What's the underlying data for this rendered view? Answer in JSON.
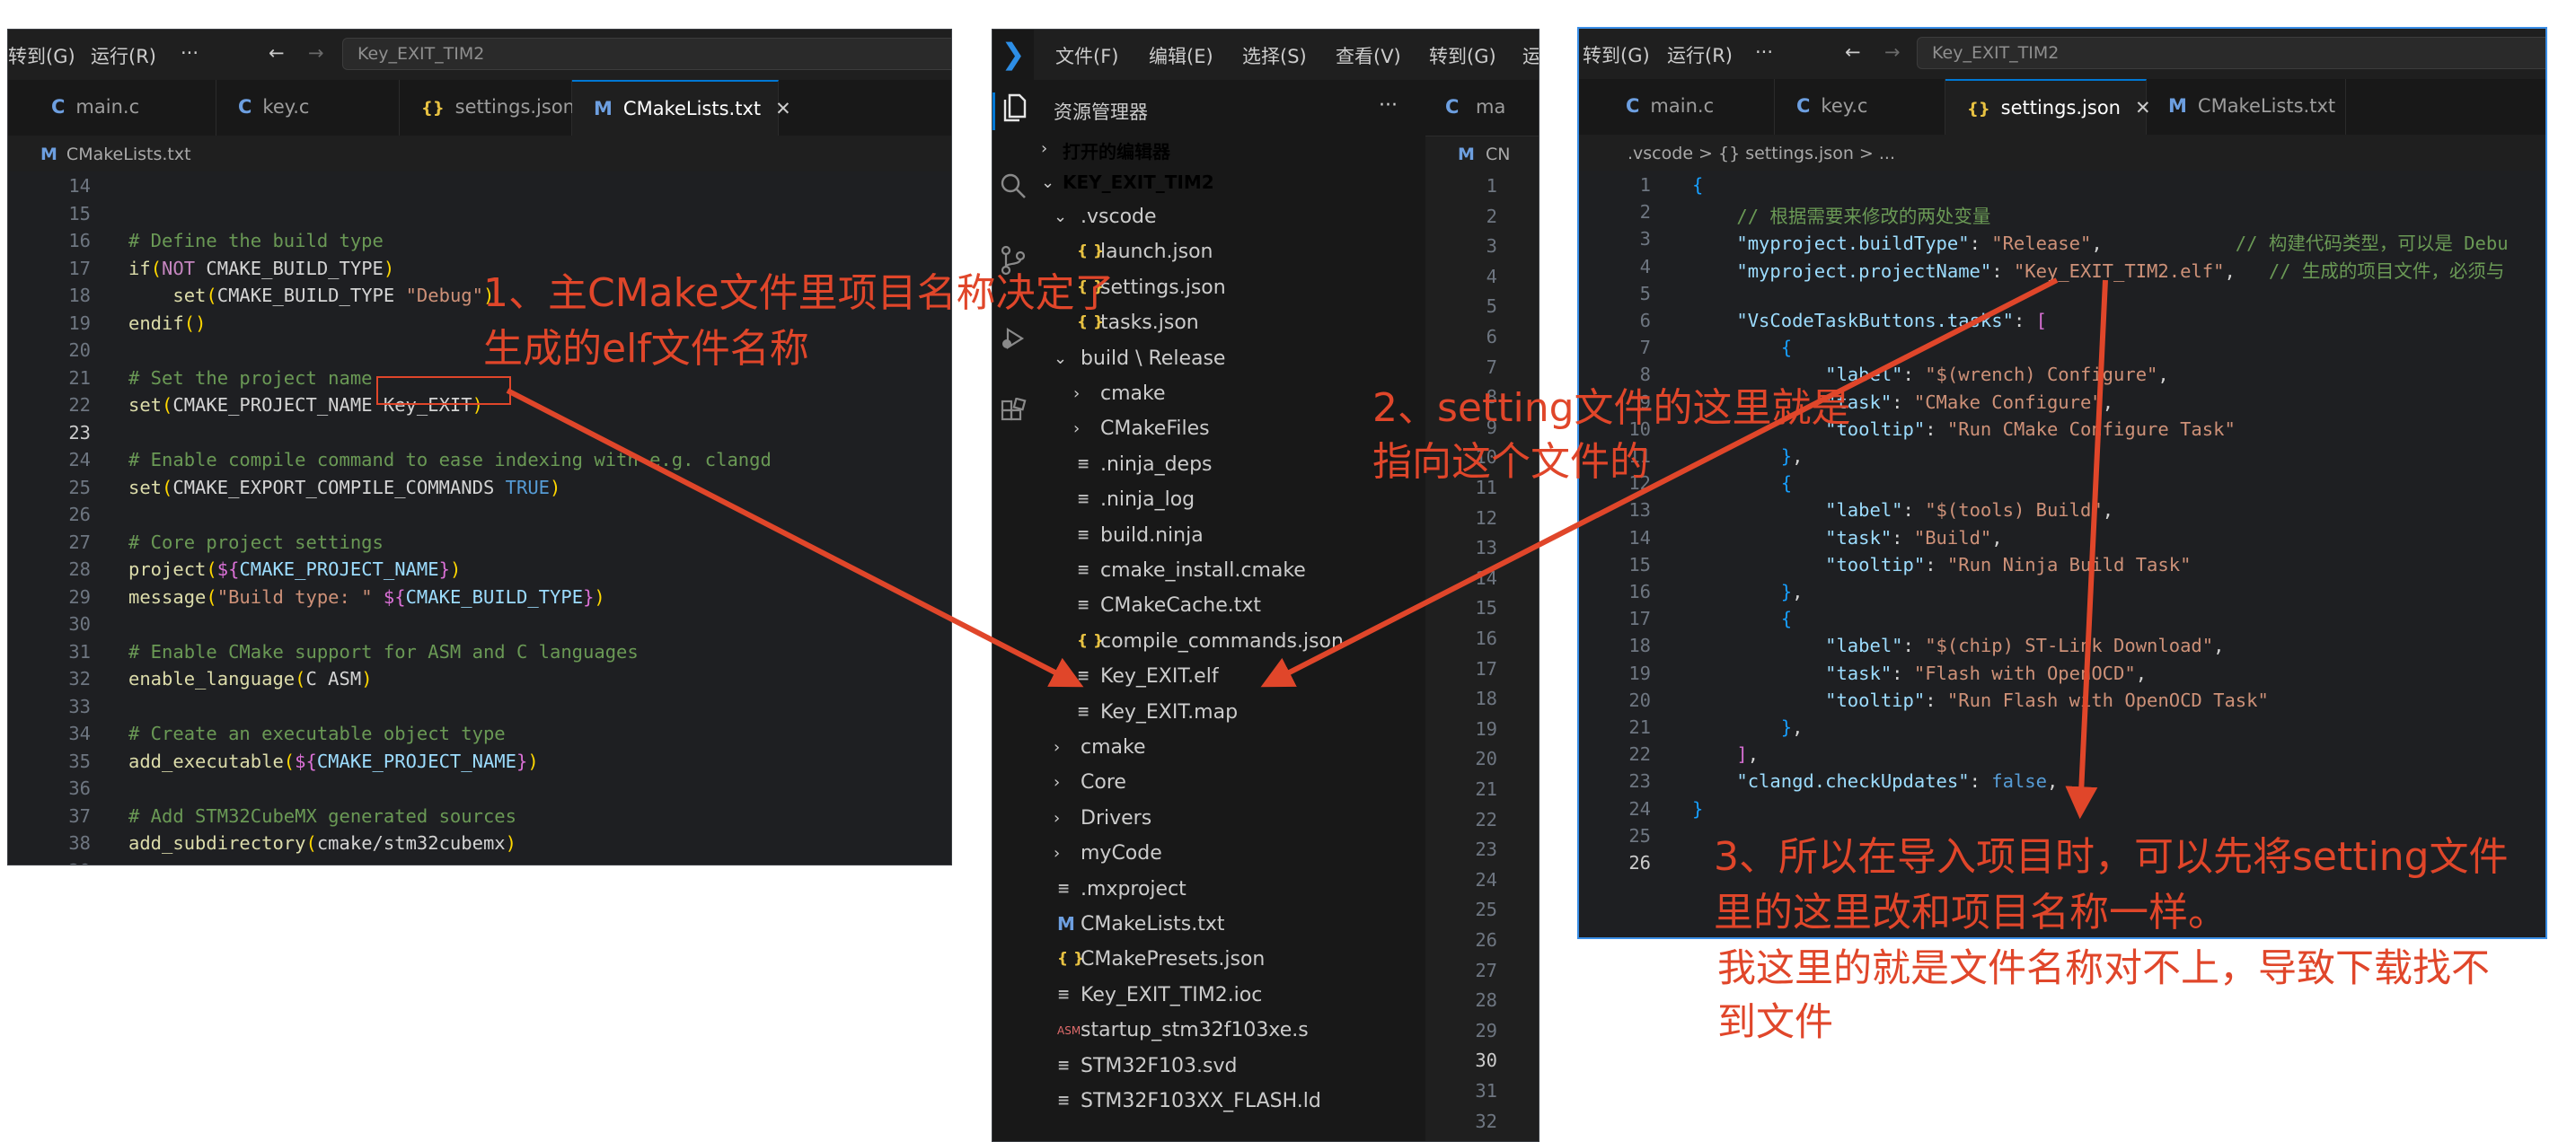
{
  "left_window": {
    "menu": [
      "转到(G)",
      "运行(R)"
    ],
    "more": "···",
    "nav_back": "←",
    "nav_forward": "→",
    "search": "Key_EXIT_TIM2",
    "tabs": [
      {
        "icon": "C",
        "label": "main.c"
      },
      {
        "icon": "C",
        "label": "key.c"
      },
      {
        "icon": "{}",
        "label": "settings.json"
      },
      {
        "icon": "M",
        "label": "CMakeLists.txt",
        "active": true
      }
    ],
    "breadcrumb": "CMakeLists.txt",
    "lines": [
      {
        "n": "14",
        "t": ""
      },
      {
        "n": "15",
        "t": ""
      },
      {
        "n": "16",
        "t": "# Define the build type"
      },
      {
        "n": "17",
        "t": "if(NOT CMAKE_BUILD_TYPE)"
      },
      {
        "n": "18",
        "t": "    set(CMAKE_BUILD_TYPE \"Debug\")"
      },
      {
        "n": "19",
        "t": "endif()"
      },
      {
        "n": "20",
        "t": ""
      },
      {
        "n": "21",
        "t": "# Set the project name"
      },
      {
        "n": "22",
        "t": "set(CMAKE_PROJECT_NAME Key_EXIT)"
      },
      {
        "n": "23",
        "t": ""
      },
      {
        "n": "24",
        "t": "# Enable compile command to ease indexing with e.g. clangd"
      },
      {
        "n": "25",
        "t": "set(CMAKE_EXPORT_COMPILE_COMMANDS TRUE)"
      },
      {
        "n": "26",
        "t": ""
      },
      {
        "n": "27",
        "t": "# Core project settings"
      },
      {
        "n": "28",
        "t": "project(${CMAKE_PROJECT_NAME})"
      },
      {
        "n": "29",
        "t": "message(\"Build type: \" ${CMAKE_BUILD_TYPE})"
      },
      {
        "n": "30",
        "t": ""
      },
      {
        "n": "31",
        "t": "# Enable CMake support for ASM and C languages"
      },
      {
        "n": "32",
        "t": "enable_language(C ASM)"
      },
      {
        "n": "33",
        "t": ""
      },
      {
        "n": "34",
        "t": "# Create an executable object type"
      },
      {
        "n": "35",
        "t": "add_executable(${CMAKE_PROJECT_NAME})"
      },
      {
        "n": "36",
        "t": ""
      },
      {
        "n": "37",
        "t": "# Add STM32CubeMX generated sources"
      },
      {
        "n": "38",
        "t": "add_subdirectory(cmake/stm32cubemx)"
      },
      {
        "n": "39",
        "t": ""
      }
    ]
  },
  "middle_window": {
    "menu": [
      "文件(F)",
      "编辑(E)",
      "选择(S)",
      "查看(V)",
      "转到(G)",
      "运"
    ],
    "explorer_title": "资源管理器",
    "more": "···",
    "open_editors": "打开的编辑器",
    "root": "KEY_EXIT_TIM2",
    "tree": [
      {
        "depth": 1,
        "chev": "v",
        "icon": "",
        "label": ".vscode"
      },
      {
        "depth": 2,
        "chev": "",
        "icon": "json",
        "label": "launch.json"
      },
      {
        "depth": 2,
        "chev": "",
        "icon": "json",
        "label": "settings.json"
      },
      {
        "depth": 2,
        "chev": "",
        "icon": "json",
        "label": "tasks.json"
      },
      {
        "depth": 1,
        "chev": "v",
        "icon": "",
        "label": "build \\ Release"
      },
      {
        "depth": 2,
        "chev": ">",
        "icon": "",
        "label": "cmake"
      },
      {
        "depth": 2,
        "chev": ">",
        "icon": "",
        "label": "CMakeFiles"
      },
      {
        "depth": 2,
        "chev": "",
        "icon": "txt",
        "label": ".ninja_deps"
      },
      {
        "depth": 2,
        "chev": "",
        "icon": "txt",
        "label": ".ninja_log"
      },
      {
        "depth": 2,
        "chev": "",
        "icon": "txt",
        "label": "build.ninja"
      },
      {
        "depth": 2,
        "chev": "",
        "icon": "txt",
        "label": "cmake_install.cmake"
      },
      {
        "depth": 2,
        "chev": "",
        "icon": "txt",
        "label": "CMakeCache.txt"
      },
      {
        "depth": 2,
        "chev": "",
        "icon": "json",
        "label": "compile_commands.json"
      },
      {
        "depth": 2,
        "chev": "",
        "icon": "txt",
        "label": "Key_EXIT.elf"
      },
      {
        "depth": 2,
        "chev": "",
        "icon": "txt",
        "label": "Key_EXIT.map"
      },
      {
        "depth": 1,
        "chev": ">",
        "icon": "",
        "label": "cmake"
      },
      {
        "depth": 1,
        "chev": ">",
        "icon": "",
        "label": "Core"
      },
      {
        "depth": 1,
        "chev": ">",
        "icon": "",
        "label": "Drivers"
      },
      {
        "depth": 1,
        "chev": ">",
        "icon": "",
        "label": "myCode"
      },
      {
        "depth": 1,
        "chev": "",
        "icon": "txt",
        "label": ".mxproject"
      },
      {
        "depth": 1,
        "chev": "",
        "icon": "m",
        "label": "CMakeLists.txt"
      },
      {
        "depth": 1,
        "chev": "",
        "icon": "json",
        "label": "CMakePresets.json"
      },
      {
        "depth": 1,
        "chev": "",
        "icon": "txt",
        "label": "Key_EXIT_TIM2.ioc"
      },
      {
        "depth": 1,
        "chev": "",
        "icon": "asm",
        "label": "startup_stm32f103xe.s"
      },
      {
        "depth": 1,
        "chev": "",
        "icon": "txt",
        "label": "STM32F103.svd"
      },
      {
        "depth": 1,
        "chev": "",
        "icon": "txt",
        "label": "STM32F103XX_FLASH.ld"
      }
    ],
    "asm_badge": "ASM",
    "partial_tab": "ma",
    "partial_crumb": "CN",
    "line_numbers": [
      "1",
      "2",
      "3",
      "4",
      "5",
      "6",
      "7",
      "8",
      "9",
      "10",
      "11",
      "12",
      "13",
      "14",
      "15",
      "16",
      "17",
      "18",
      "19",
      "20",
      "21",
      "22",
      "23",
      "24",
      "25",
      "26",
      "27",
      "28",
      "29",
      "30",
      "31",
      "32"
    ]
  },
  "right_window": {
    "menu": [
      "转到(G)",
      "运行(R)"
    ],
    "more": "···",
    "nav_back": "←",
    "nav_forward": "→",
    "search": "Key_EXIT_TIM2",
    "tabs": [
      {
        "icon": "C",
        "label": "main.c"
      },
      {
        "icon": "C",
        "label": "key.c"
      },
      {
        "icon": "{}",
        "label": "settings.json",
        "active": true
      },
      {
        "icon": "M",
        "label": "CMakeLists.txt"
      }
    ],
    "breadcrumb": ".vscode > {} settings.json > ...",
    "lines": [
      {
        "n": "1",
        "t": "{"
      },
      {
        "n": "2",
        "t": "    // 根据需要来修改的两处变量"
      },
      {
        "n": "3",
        "t": "    \"myproject.buildType\": \"Release\",            // 构建代码类型，可以是 Debu"
      },
      {
        "n": "4",
        "t": "    \"myproject.projectName\": \"Key_EXIT_TIM2.elf\",   // 生成的项目文件，必须与"
      },
      {
        "n": "5",
        "t": ""
      },
      {
        "n": "6",
        "t": "    \"VsCodeTaskButtons.tasks\": ["
      },
      {
        "n": "7",
        "t": "        {"
      },
      {
        "n": "8",
        "t": "            \"label\": \"$(wrench) Configure\","
      },
      {
        "n": "9",
        "t": "            \"task\": \"CMake Configure\","
      },
      {
        "n": "10",
        "t": "            \"tooltip\": \"Run CMake Configure Task\""
      },
      {
        "n": "11",
        "t": "        },"
      },
      {
        "n": "12",
        "t": "        {"
      },
      {
        "n": "13",
        "t": "            \"label\": \"$(tools) Build\","
      },
      {
        "n": "14",
        "t": "            \"task\": \"Build\","
      },
      {
        "n": "15",
        "t": "            \"tooltip\": \"Run Ninja Build Task\""
      },
      {
        "n": "16",
        "t": "        },"
      },
      {
        "n": "17",
        "t": "        {"
      },
      {
        "n": "18",
        "t": "            \"label\": \"$(chip) ST-Link Download\","
      },
      {
        "n": "19",
        "t": "            \"task\": \"Flash with OpenOCD\","
      },
      {
        "n": "20",
        "t": "            \"tooltip\": \"Run Flash with OpenOCD Task\""
      },
      {
        "n": "21",
        "t": "        },"
      },
      {
        "n": "22",
        "t": "    ],"
      },
      {
        "n": "23",
        "t": "    \"clangd.checkUpdates\": false,"
      },
      {
        "n": "24",
        "t": "}"
      },
      {
        "n": "25",
        "t": ""
      },
      {
        "n": "26",
        "t": ""
      }
    ]
  },
  "annotations": {
    "note1_line1": "1、主CMake文件里项目名称决定了",
    "note1_line2": "生成的elf文件名称",
    "note2_line1": "2、setting文件的这里就是",
    "note2_line2": "指向这个文件的",
    "note3_line1": "3、所以在导入项目时，可以先将setting文件",
    "note3_line2": "里的这里改和项目名称一样。",
    "note4_line1": "我这里的就是文件名称对不上，导致下载找不",
    "note4_line2": "到文件",
    "color": "#e0462a"
  }
}
